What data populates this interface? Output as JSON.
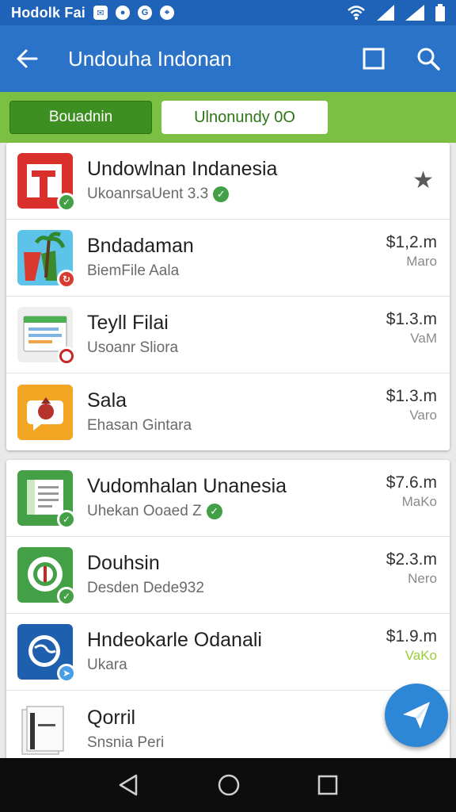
{
  "status": {
    "title": "Hodolk Fai",
    "notifications": [
      "mail-icon",
      "record-icon",
      "g-icon",
      "location-icon"
    ]
  },
  "appbar": {
    "title": "Undouha Indonan"
  },
  "filters": {
    "primary_label": "Bouadnin",
    "secondary_label": "Ulnonundy 0O"
  },
  "lists": [
    {
      "items": [
        {
          "name": "Undowlnan Indanesia",
          "subtitle": "UkoanrsaUent 3.3",
          "verified": true,
          "starred": true,
          "icon": "red-building-icon"
        },
        {
          "name": "Bndadaman",
          "subtitle": "BiemFile Aala",
          "price": "$1,2.m",
          "unit": "Maro",
          "icon": "palm-tree-icon"
        },
        {
          "name": "Teyll Filai",
          "subtitle": "Usoanr Sliora",
          "price": "$1.3.m",
          "unit": "VaM",
          "icon": "document-icon"
        },
        {
          "name": "Sala",
          "subtitle": "Ehasan Gintara",
          "price": "$1.3.m",
          "unit": "Varo",
          "icon": "chat-icon"
        }
      ]
    },
    {
      "items": [
        {
          "name": "Vudomhalan Unanesia",
          "subtitle": "Uhekan Ooaed Z",
          "verified": true,
          "price": "$7.6.m",
          "unit": "MaKo",
          "icon": "green-file-icon"
        },
        {
          "name": "Douhsin",
          "subtitle": "Desden Dede932",
          "price": "$2.3.m",
          "unit": "Nero",
          "icon": "green-badge-icon"
        },
        {
          "name": "Hndeokarle Odanali",
          "subtitle": "Ukara",
          "price": "$1.9.m",
          "unit": "VaKo",
          "unit_color": "green",
          "icon": "globe-icon"
        },
        {
          "name": "Qorril",
          "subtitle": "Snsnia Peri",
          "icon": "card-stack-icon"
        }
      ]
    }
  ],
  "colors": {
    "status_bar": "#1f63b8",
    "app_bar": "#2b73c9",
    "filter_bar": "#7cc043",
    "fab": "#2d86d6"
  }
}
